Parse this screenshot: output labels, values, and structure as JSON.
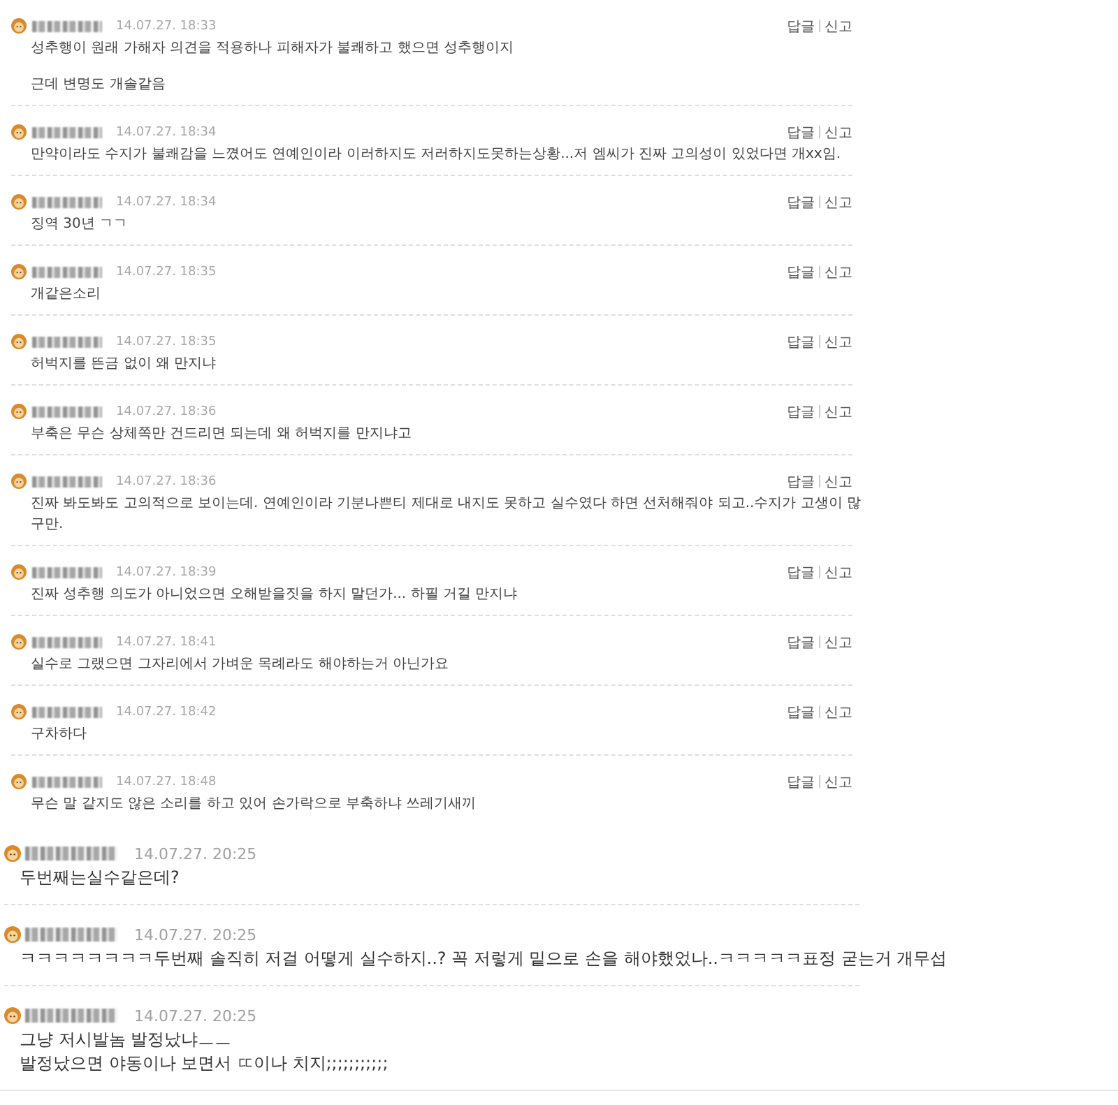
{
  "sections": [
    {
      "kind": "compact",
      "comments": [
        {
          "date": "14.07.27. 18:33",
          "paragraphs": [
            [
              "성추행이 원래 가해자 의견을 적용하나 피해자가 불쾌하고 했으면 성추행이지"
            ],
            [
              "근데 변명도 개솔같음"
            ]
          ],
          "actions": [
            "답글",
            "신고"
          ]
        },
        {
          "date": "14.07.27. 18:34",
          "paragraphs": [
            [
              "만약이라도 수지가 불쾌감을 느꼈어도 연예인이라 이러하지도 저러하지도못하는상황...저 엠씨가 진짜 고의성이 있었다면 개xx임."
            ]
          ],
          "actions": [
            "답글",
            "신고"
          ]
        },
        {
          "date": "14.07.27. 18:34",
          "paragraphs": [
            [
              "징역 30년 ㄱㄱ"
            ]
          ],
          "actions": [
            "답글",
            "신고"
          ]
        },
        {
          "date": "14.07.27. 18:35",
          "paragraphs": [
            [
              "개같은소리"
            ]
          ],
          "actions": [
            "답글",
            "신고"
          ]
        },
        {
          "date": "14.07.27. 18:35",
          "paragraphs": [
            [
              "허벅지를 뜬금 없이 왜 만지냐"
            ]
          ],
          "actions": [
            "답글",
            "신고"
          ]
        },
        {
          "date": "14.07.27. 18:36",
          "paragraphs": [
            [
              "부축은 무슨 상체쪽만 건드리면 되는데 왜 허벅지를 만지냐고"
            ]
          ],
          "actions": [
            "답글",
            "신고"
          ]
        },
        {
          "date": "14.07.27. 18:36",
          "paragraphs": [
            [
              "진짜 봐도봐도 고의적으로 보이는데. 연예인이라 기분나쁜티 제대로 내지도 못하고 실수였다 하면 선처해줘야 되고..수지가 고생이 많",
              "구만."
            ]
          ],
          "actions": [
            "답글",
            "신고"
          ]
        },
        {
          "date": "14.07.27. 18:39",
          "paragraphs": [
            [
              "진짜 성추행 의도가 아니었으면 오해받을짓을 하지 말던가... 하필 거길 만지냐"
            ]
          ],
          "actions": [
            "답글",
            "신고"
          ]
        },
        {
          "date": "14.07.27. 18:41",
          "paragraphs": [
            [
              "실수로 그랬으면 그자리에서 가벼운 목례라도 해야하는거 아닌가요"
            ]
          ],
          "actions": [
            "답글",
            "신고"
          ]
        },
        {
          "date": "14.07.27. 18:42",
          "paragraphs": [
            [
              "구차하다"
            ]
          ],
          "actions": [
            "답글",
            "신고"
          ]
        },
        {
          "date": "14.07.27. 18:48",
          "paragraphs": [
            [
              "무슨 말 같지도 않은 소리를 하고 있어 손가락으로 부축하냐 쓰레기새끼"
            ]
          ],
          "actions": [
            "답글",
            "신고"
          ]
        }
      ]
    },
    {
      "kind": "large",
      "comments": [
        {
          "date": "14.07.27. 20:25",
          "paragraphs": [
            [
              "두번째는실수같은데?"
            ]
          ]
        },
        {
          "date": "14.07.27. 20:25",
          "paragraphs": [
            [
              "ㅋㅋㅋㅋㅋㅋㅋㅋ두번째 솔직히 저걸 어떻게 실수하지..? 꼭 저렇게 밑으로 손을 해야했었나..ㅋㅋㅋㅋㅋ표정 굳는거 개무섭"
            ]
          ]
        },
        {
          "date": "14.07.27. 20:25",
          "paragraphs": [
            [
              "그냥 저시발놈 발정났냐ㅡㅡ",
              "발정났으면 야동이나 보면서 ㄸ이나 치지;;;;;;;;;;;"
            ]
          ]
        }
      ]
    }
  ]
}
